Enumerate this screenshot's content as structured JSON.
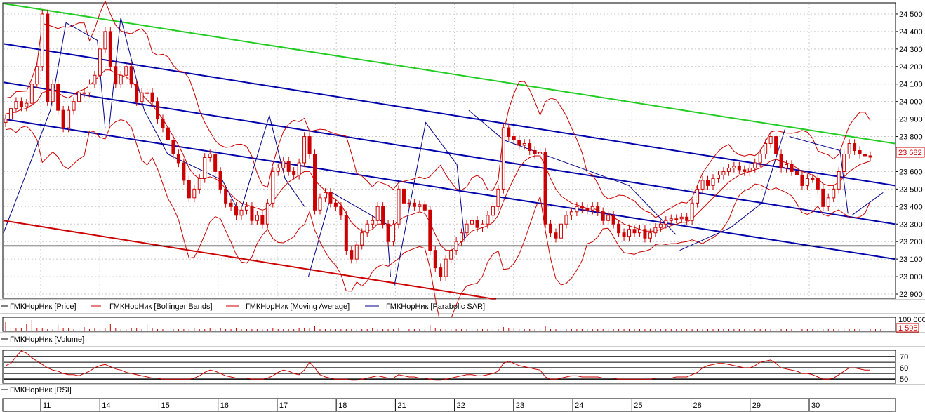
{
  "chart_data": {
    "type": "line",
    "price_axis": {
      "ticks": [
        "24 500",
        "24 400",
        "24 300",
        "24 200",
        "24 100",
        "24 000",
        "23 900",
        "23 800",
        "23 700",
        "23 600",
        "23 500",
        "23 400",
        "23 300",
        "23 200",
        "23 100",
        "23 000",
        "22 900"
      ],
      "tick_values": [
        24500,
        24400,
        24300,
        24200,
        24100,
        24000,
        23900,
        23800,
        23700,
        23600,
        23500,
        23400,
        23300,
        23200,
        23100,
        23000,
        22900
      ],
      "ylim": [
        22880,
        24560
      ],
      "last_price_label": "23 682",
      "last_price": 23682
    },
    "volume_axis": {
      "ticks": [
        "100 000"
      ],
      "last_value_label": "1 595"
    },
    "rsi_axis": {
      "ticks": [
        "70",
        "60",
        "50"
      ],
      "tick_values": [
        70,
        60,
        50
      ],
      "ylim": [
        47,
        75
      ]
    },
    "x_axis": {
      "day_labels": [
        "11",
        "14",
        "15",
        "16",
        "17",
        "18",
        "21",
        "22",
        "23",
        "24",
        "25",
        "28",
        "29",
        "30"
      ]
    },
    "legend_price": [
      {
        "label": "ГМКНорНик [Price]",
        "color": "#000000"
      },
      {
        "label": "ГМКНорНик [Bollinger Bands]",
        "color": "#cc0000"
      },
      {
        "label": "ГМКНорНик [Moving Average]",
        "color": "#cc0000"
      },
      {
        "label": "ГМКНорНик [Parabolic SAR]",
        "color": "#00008b"
      }
    ],
    "legend_volume": "ГМКНорНик [Volume]",
    "legend_rsi": "ГМКНорНик [RSI]",
    "price_close": [
      23900,
      23960,
      24000,
      23970,
      23990,
      24100,
      24200,
      24500,
      24000,
      24100,
      23950,
      23850,
      23950,
      24000,
      24050,
      24050,
      24100,
      24150,
      24300,
      24400,
      24200,
      24100,
      24150,
      24200,
      24100,
      24000,
      24050,
      24050,
      24000,
      23900,
      23850,
      23780,
      23700,
      23650,
      23550,
      23450,
      23500,
      23560,
      23680,
      23700,
      23600,
      23500,
      23420,
      23400,
      23350,
      23380,
      23400,
      23320,
      23350,
      23300,
      23420,
      23600,
      23620,
      23660,
      23600,
      23580,
      23650,
      23800,
      23700,
      23380,
      23450,
      23480,
      23420,
      23400,
      23350,
      23150,
      23100,
      23180,
      23250,
      23300,
      23320,
      23400,
      23300,
      23200,
      23300,
      23500,
      23420,
      23420,
      23400,
      23410,
      23380,
      23150,
      23050,
      23000,
      23100,
      23150,
      23200,
      23250,
      23300,
      23320,
      23280,
      23300,
      23350,
      23400,
      23500,
      23850,
      23800,
      23780,
      23750,
      23760,
      23720,
      23700,
      23710,
      23300,
      23250,
      23220,
      23300,
      23350,
      23370,
      23400,
      23390,
      23380,
      23400,
      23370,
      23320,
      23350,
      23300,
      23250,
      23230,
      23270,
      23250,
      23270,
      23220,
      23250,
      23280,
      23300,
      23320,
      23330,
      23330,
      23340,
      23320,
      23420,
      23500,
      23550,
      23520,
      23560,
      23580,
      23600,
      23620,
      23630,
      23610,
      23600,
      23620,
      23650,
      23700,
      23760,
      23800,
      23700,
      23620,
      23640,
      23600,
      23580,
      23520,
      23560,
      23560,
      23500,
      23400,
      23450,
      23500,
      23600,
      23700,
      23760,
      23720,
      23700,
      23690,
      23682
    ],
    "sma": [
      23930,
      23935,
      23940,
      23955,
      23960,
      23980,
      24000,
      24050,
      24060,
      24070,
      24050,
      24030,
      24020,
      24040,
      24060,
      24070,
      24090,
      24120,
      24150,
      24180,
      24180,
      24160,
      24150,
      24140,
      24120,
      24080,
      24040,
      24010,
      23980,
      23940,
      23900,
      23850,
      23800,
      23750,
      23690,
      23620,
      23580,
      23560,
      23560,
      23570,
      23560,
      23540,
      23500,
      23470,
      23440,
      23420,
      23410,
      23400,
      23390,
      23380,
      23390,
      23430,
      23470,
      23510,
      23540,
      23560,
      23580,
      23600,
      23600,
      23550,
      23520,
      23490,
      23460,
      23440,
      23410,
      23360,
      23310,
      23280,
      23260,
      23260,
      23270,
      23300,
      23300,
      23290,
      23290,
      23320,
      23340,
      23350,
      23360,
      23370,
      23360,
      23310,
      23240,
      23180,
      23150,
      23150,
      23170,
      23200,
      23230,
      23260,
      23270,
      23280,
      23290,
      23310,
      23350,
      23430,
      23500,
      23560,
      23620,
      23660,
      23680,
      23690,
      23690,
      23630,
      23560,
      23500,
      23460,
      23440,
      23420,
      23410,
      23400,
      23390,
      23390,
      23380,
      23370,
      23360,
      23340,
      23320,
      23300,
      23290,
      23280,
      23270,
      23260,
      23260,
      23260,
      23270,
      23280,
      23290,
      23300,
      23310,
      23310,
      23330,
      23360,
      23390,
      23420,
      23450,
      23480,
      23510,
      23540,
      23560,
      23580,
      23590,
      23600,
      23610,
      23620,
      23640,
      23660,
      23670,
      23660,
      23650,
      23640,
      23620,
      23600,
      23590,
      23580,
      23560,
      23530,
      23520,
      23520,
      23540,
      23570,
      23600,
      23620,
      23640,
      23650,
      23660
    ],
    "sar_segments": [
      [
        [
          0,
          23250
        ],
        [
          12,
          23950
        ],
        [
          16,
          24450
        ],
        [
          24,
          24350
        ],
        [
          26,
          23850
        ]
      ],
      [
        [
          27,
          23850
        ],
        [
          30,
          24480
        ],
        [
          36,
          23950
        ],
        [
          42,
          23700
        ],
        [
          56,
          23550
        ],
        [
          60,
          23380
        ]
      ],
      [
        [
          61,
          23400
        ],
        [
          68,
          23920
        ],
        [
          72,
          23560
        ],
        [
          77,
          23400
        ]
      ],
      [
        [
          78,
          23000
        ],
        [
          84,
          23480
        ],
        [
          98,
          23300
        ],
        [
          99,
          23000
        ]
      ],
      [
        [
          100,
          22950
        ],
        [
          108,
          23880
        ],
        [
          116,
          23640
        ],
        [
          118,
          23200
        ]
      ],
      [
        [
          119,
          23950
        ],
        [
          128,
          23780
        ],
        [
          160,
          23520
        ],
        [
          172,
          23240
        ]
      ],
      [
        [
          173,
          23150
        ],
        [
          186,
          23280
        ],
        [
          194,
          23420
        ],
        [
          200,
          23850
        ]
      ],
      [
        [
          201,
          23800
        ],
        [
          214,
          23720
        ],
        [
          216,
          23360
        ]
      ],
      [
        [
          217,
          23350
        ],
        [
          225,
          23480
        ]
      ]
    ],
    "bands": {
      "top_green": {
        "from": [
          0,
          24560
        ],
        "to": [
          228,
          23760
        ]
      },
      "blue_upper": {
        "from": [
          0,
          24330
        ],
        "to": [
          228,
          23520
        ]
      },
      "blue_mid": {
        "from": [
          0,
          24110
        ],
        "to": [
          228,
          23300
        ]
      },
      "blue_lower": {
        "from": [
          0,
          23900
        ],
        "to": [
          228,
          23100
        ]
      },
      "red_bottom": {
        "from": [
          0,
          23320
        ],
        "to": [
          126,
          22870
        ]
      },
      "horizontal_black": 23175
    },
    "rsi": [
      62,
      64,
      70,
      75,
      73,
      69,
      66,
      63,
      60,
      58,
      57,
      55,
      54,
      54,
      53,
      55,
      57,
      60,
      62,
      63,
      61,
      59,
      58,
      56,
      55,
      54,
      53,
      52,
      51,
      51,
      50,
      50,
      50,
      50,
      50,
      50,
      51,
      53,
      56,
      58,
      57,
      55,
      53,
      52,
      51,
      51,
      51,
      50,
      50,
      50,
      51,
      53,
      56,
      58,
      57,
      55,
      54,
      58,
      65,
      60,
      54,
      52,
      51,
      50,
      50,
      50,
      49,
      49,
      50,
      51,
      52,
      53,
      52,
      51,
      51,
      54,
      53,
      52,
      52,
      51,
      51,
      50,
      49,
      49,
      50,
      51,
      52,
      53,
      54,
      54,
      53,
      53,
      54,
      55,
      57,
      64,
      66,
      64,
      62,
      61,
      60,
      59,
      58,
      52,
      50,
      50,
      51,
      52,
      53,
      53,
      52,
      52,
      52,
      52,
      51,
      51,
      51,
      50,
      50,
      50,
      50,
      50,
      50,
      50,
      51,
      51,
      51,
      51,
      52,
      52,
      52,
      54,
      56,
      60,
      62,
      63,
      64,
      64,
      63,
      62,
      61,
      60,
      60,
      62,
      65,
      66,
      67,
      64,
      60,
      59,
      58,
      57,
      55,
      55,
      54,
      52,
      50,
      50,
      51,
      54,
      57,
      60,
      60,
      59,
      58,
      58
    ],
    "volume_spikes": [
      12,
      5,
      4,
      3,
      10,
      15,
      4,
      3,
      2,
      2,
      8,
      3,
      4,
      2,
      3,
      5,
      2,
      3,
      2,
      4,
      9,
      3,
      2,
      2,
      3,
      3,
      2,
      10,
      4,
      2,
      2,
      3,
      2,
      2,
      2,
      2,
      3,
      2,
      2,
      3,
      2,
      3,
      2,
      2,
      3,
      2,
      2,
      2,
      2,
      2,
      2,
      3,
      2,
      2,
      2,
      2,
      3,
      4,
      3,
      6,
      2,
      2,
      2,
      2,
      2,
      2,
      2,
      2,
      2,
      2,
      3,
      2,
      2,
      2,
      2,
      4,
      2,
      2,
      2,
      2,
      2,
      8,
      4,
      2,
      2,
      2,
      2,
      2,
      2,
      2,
      2,
      2,
      2,
      2,
      2,
      5,
      3,
      3,
      2,
      2,
      2,
      2,
      2,
      7,
      2,
      2,
      2,
      2,
      2,
      2,
      2,
      2,
      2,
      2,
      2,
      2,
      2,
      2,
      2,
      2,
      2,
      2,
      2,
      2,
      2,
      2,
      2,
      2,
      2,
      2,
      2,
      2,
      2,
      2,
      2,
      2,
      2,
      2,
      2,
      2,
      2,
      2,
      2,
      2,
      2,
      2,
      2,
      2,
      2,
      2,
      2,
      2,
      2,
      2,
      2,
      2,
      2,
      2,
      2,
      2,
      2,
      2,
      2,
      2,
      2,
      2,
      2,
      2
    ]
  }
}
